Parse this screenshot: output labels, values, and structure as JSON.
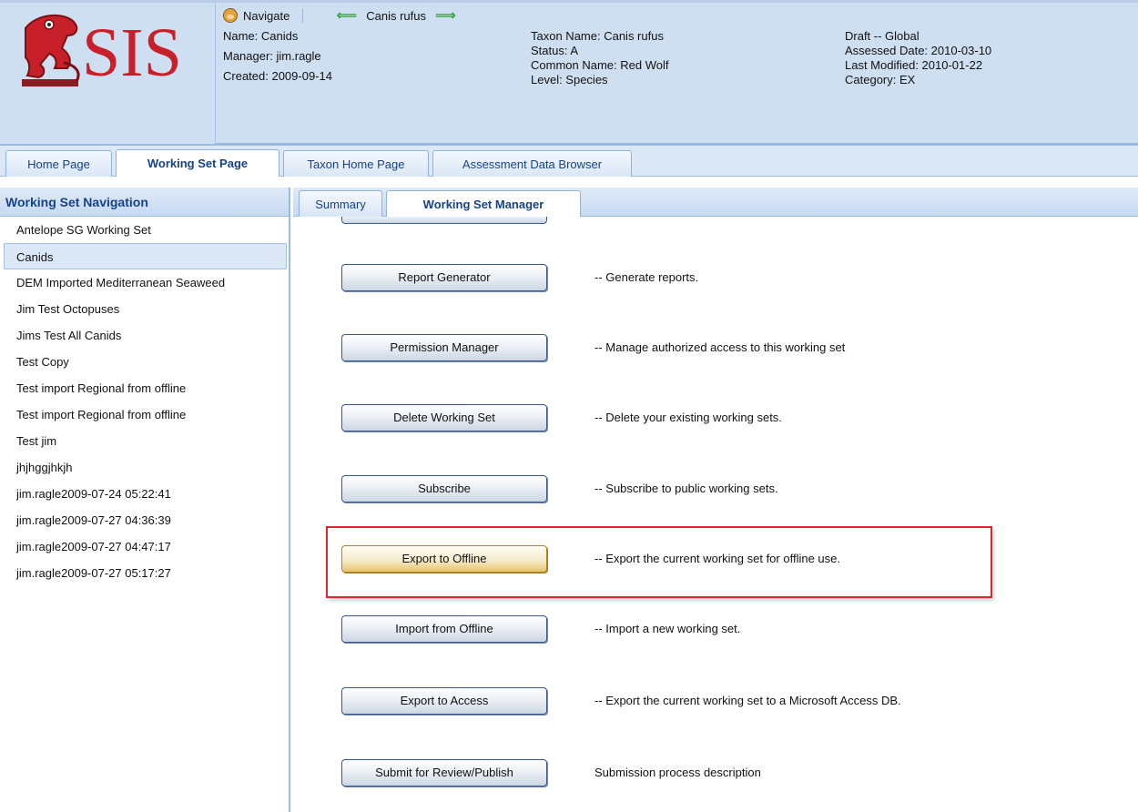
{
  "header": {
    "logo_text": "SIS",
    "nav": {
      "label": "Navigate",
      "taxon": "Canis rufus"
    },
    "working_set": {
      "name": "Name: Canids",
      "manager": "Manager: jim.ragle",
      "created": "Created: 2009-09-14"
    },
    "taxon": {
      "name": "Taxon Name: Canis rufus",
      "status": "Status: A",
      "common_name": "Common Name: Red Wolf",
      "level": "Level: Species"
    },
    "assessment": {
      "draft": "Draft -- Global",
      "assessed": "Assessed Date: 2010-03-10",
      "modified": "Last Modified: 2010-01-22",
      "category": "Category: EX"
    }
  },
  "main_tabs": [
    "Home Page",
    "Working Set Page",
    "Taxon Home Page",
    "Assessment Data Browser"
  ],
  "left_panel": {
    "title": "Working Set Navigation",
    "items": [
      "Antelope SG Working Set",
      "Canids",
      "DEM Imported Mediterranean Seaweed",
      "Jim Test Octopuses",
      "Jims Test All Canids",
      "Test Copy",
      "Test import Regional from offline",
      "Test import Regional from offline",
      "Test jim",
      "jhjhggjhkjh",
      "jim.ragle2009-07-24 05:22:41",
      "jim.ragle2009-07-27 04:36:39",
      "jim.ragle2009-07-27 04:47:17",
      "jim.ragle2009-07-27 05:17:27"
    ]
  },
  "sub_tabs": [
    "Summary",
    "Working Set Manager"
  ],
  "actions": [
    {
      "button": "Report Generator",
      "desc": "-- Generate reports."
    },
    {
      "button": "Permission Manager",
      "desc": "-- Manage authorized access to this working set"
    },
    {
      "button": "Delete Working Set",
      "desc": "-- Delete your existing working sets."
    },
    {
      "button": "Subscribe",
      "desc": "-- Subscribe to public working sets."
    },
    {
      "button": "Export to Offline",
      "desc": "-- Export the current working set for offline use."
    },
    {
      "button": "Import from Offline",
      "desc": "-- Import a new working set."
    },
    {
      "button": "Export to Access",
      "desc": "-- Export the current working set to a Microsoft Access DB."
    },
    {
      "button": "Submit for Review/Publish",
      "desc": "Submission process description"
    }
  ],
  "colors": {
    "header_bg": "#cfdff2",
    "tab_text": "#15428b",
    "highlight": "#e0262b",
    "logo_red": "#c8202a"
  },
  "icons": [
    "sis-logo-icon",
    "monkey-icon",
    "arrow-left-icon",
    "arrow-right-icon"
  ]
}
